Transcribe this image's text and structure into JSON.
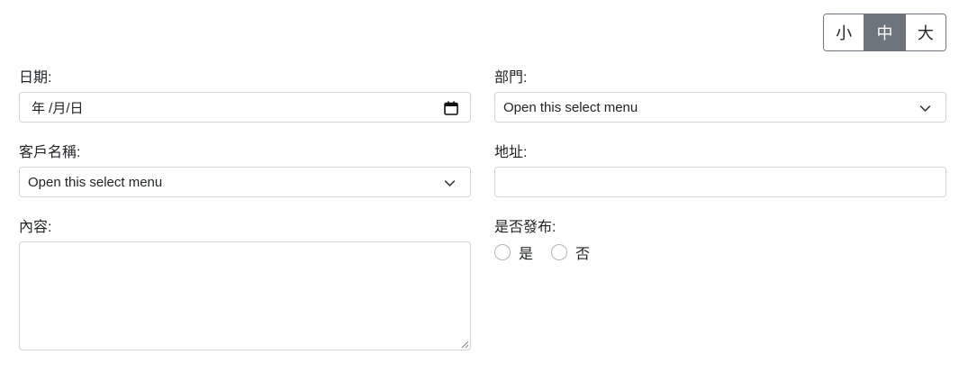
{
  "font_size_toggle": {
    "options": [
      {
        "label": "小",
        "active": false
      },
      {
        "label": "中",
        "active": true
      },
      {
        "label": "大",
        "active": false
      }
    ]
  },
  "date_field": {
    "label": "日期:",
    "value": "年 /月/日",
    "icon": "calendar-icon"
  },
  "department_field": {
    "label": "部門:",
    "selected": "Open this select menu",
    "icon": "chevron-down-icon"
  },
  "customer_field": {
    "label": "客戶名稱:",
    "selected": "Open this select menu",
    "icon": "chevron-down-icon"
  },
  "address_field": {
    "label": "地址:",
    "value": ""
  },
  "content_field": {
    "label": "內容:",
    "value": ""
  },
  "publish_field": {
    "label": "是否發布:",
    "options": [
      "是",
      "否"
    ]
  },
  "colors": {
    "active_toggle": "#6c757d",
    "border": "#ced4da",
    "text": "#212529"
  }
}
